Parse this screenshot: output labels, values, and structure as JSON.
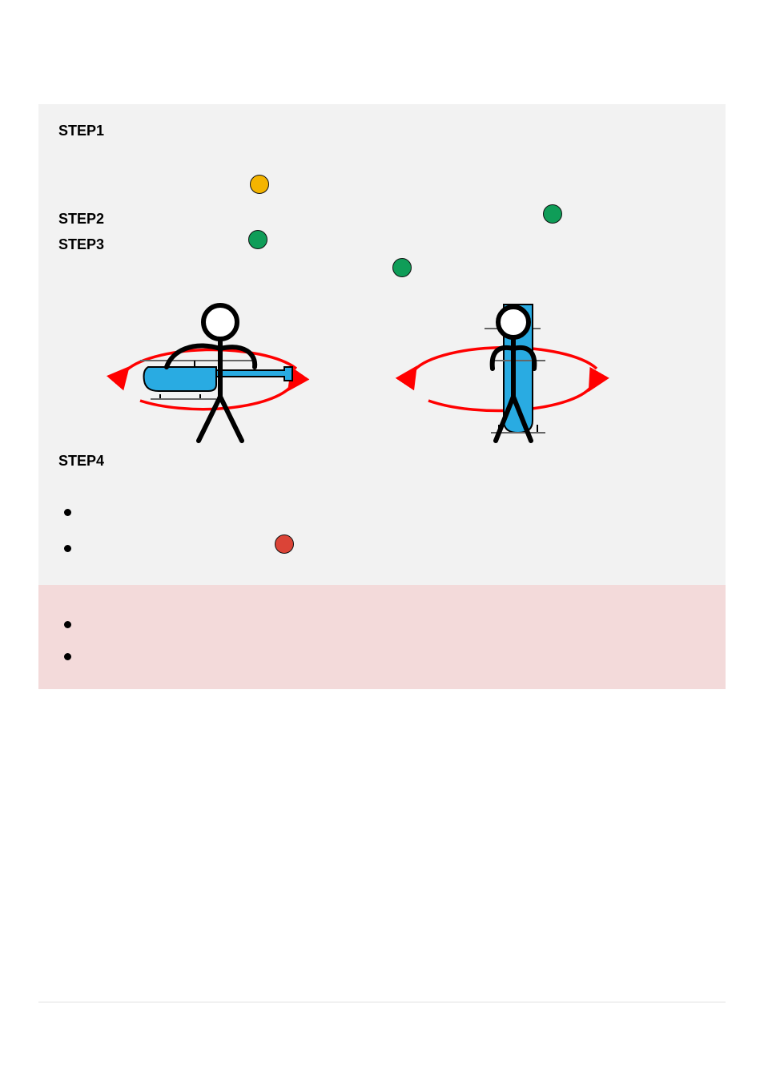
{
  "labels": {
    "step1": "STEP1",
    "step2": "STEP2",
    "step3": "STEP3",
    "step4": "STEP4"
  },
  "colors": {
    "panel_gray": "#f2f2f2",
    "panel_pink": "#f3dada",
    "dot_yellow": "#f4b400",
    "dot_green": "#0f9d58",
    "dot_red": "#db4437",
    "arrow_red": "#ff0000",
    "heli_blue": "#29abe2",
    "stroke": "#000000"
  }
}
